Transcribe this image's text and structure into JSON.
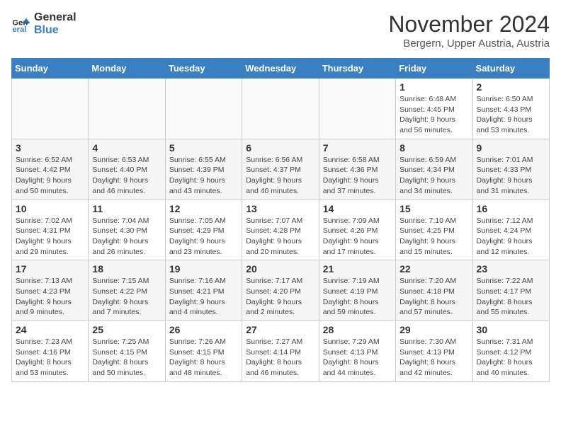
{
  "logo": {
    "line1": "General",
    "line2": "Blue"
  },
  "title": "November 2024",
  "location": "Bergern, Upper Austria, Austria",
  "days_of_week": [
    "Sunday",
    "Monday",
    "Tuesday",
    "Wednesday",
    "Thursday",
    "Friday",
    "Saturday"
  ],
  "weeks": [
    [
      {
        "day": "",
        "info": ""
      },
      {
        "day": "",
        "info": ""
      },
      {
        "day": "",
        "info": ""
      },
      {
        "day": "",
        "info": ""
      },
      {
        "day": "",
        "info": ""
      },
      {
        "day": "1",
        "info": "Sunrise: 6:48 AM\nSunset: 4:45 PM\nDaylight: 9 hours\nand 56 minutes."
      },
      {
        "day": "2",
        "info": "Sunrise: 6:50 AM\nSunset: 4:43 PM\nDaylight: 9 hours\nand 53 minutes."
      }
    ],
    [
      {
        "day": "3",
        "info": "Sunrise: 6:52 AM\nSunset: 4:42 PM\nDaylight: 9 hours\nand 50 minutes."
      },
      {
        "day": "4",
        "info": "Sunrise: 6:53 AM\nSunset: 4:40 PM\nDaylight: 9 hours\nand 46 minutes."
      },
      {
        "day": "5",
        "info": "Sunrise: 6:55 AM\nSunset: 4:39 PM\nDaylight: 9 hours\nand 43 minutes."
      },
      {
        "day": "6",
        "info": "Sunrise: 6:56 AM\nSunset: 4:37 PM\nDaylight: 9 hours\nand 40 minutes."
      },
      {
        "day": "7",
        "info": "Sunrise: 6:58 AM\nSunset: 4:36 PM\nDaylight: 9 hours\nand 37 minutes."
      },
      {
        "day": "8",
        "info": "Sunrise: 6:59 AM\nSunset: 4:34 PM\nDaylight: 9 hours\nand 34 minutes."
      },
      {
        "day": "9",
        "info": "Sunrise: 7:01 AM\nSunset: 4:33 PM\nDaylight: 9 hours\nand 31 minutes."
      }
    ],
    [
      {
        "day": "10",
        "info": "Sunrise: 7:02 AM\nSunset: 4:31 PM\nDaylight: 9 hours\nand 29 minutes."
      },
      {
        "day": "11",
        "info": "Sunrise: 7:04 AM\nSunset: 4:30 PM\nDaylight: 9 hours\nand 26 minutes."
      },
      {
        "day": "12",
        "info": "Sunrise: 7:05 AM\nSunset: 4:29 PM\nDaylight: 9 hours\nand 23 minutes."
      },
      {
        "day": "13",
        "info": "Sunrise: 7:07 AM\nSunset: 4:28 PM\nDaylight: 9 hours\nand 20 minutes."
      },
      {
        "day": "14",
        "info": "Sunrise: 7:09 AM\nSunset: 4:26 PM\nDaylight: 9 hours\nand 17 minutes."
      },
      {
        "day": "15",
        "info": "Sunrise: 7:10 AM\nSunset: 4:25 PM\nDaylight: 9 hours\nand 15 minutes."
      },
      {
        "day": "16",
        "info": "Sunrise: 7:12 AM\nSunset: 4:24 PM\nDaylight: 9 hours\nand 12 minutes."
      }
    ],
    [
      {
        "day": "17",
        "info": "Sunrise: 7:13 AM\nSunset: 4:23 PM\nDaylight: 9 hours\nand 9 minutes."
      },
      {
        "day": "18",
        "info": "Sunrise: 7:15 AM\nSunset: 4:22 PM\nDaylight: 9 hours\nand 7 minutes."
      },
      {
        "day": "19",
        "info": "Sunrise: 7:16 AM\nSunset: 4:21 PM\nDaylight: 9 hours\nand 4 minutes."
      },
      {
        "day": "20",
        "info": "Sunrise: 7:17 AM\nSunset: 4:20 PM\nDaylight: 9 hours\nand 2 minutes."
      },
      {
        "day": "21",
        "info": "Sunrise: 7:19 AM\nSunset: 4:19 PM\nDaylight: 8 hours\nand 59 minutes."
      },
      {
        "day": "22",
        "info": "Sunrise: 7:20 AM\nSunset: 4:18 PM\nDaylight: 8 hours\nand 57 minutes."
      },
      {
        "day": "23",
        "info": "Sunrise: 7:22 AM\nSunset: 4:17 PM\nDaylight: 8 hours\nand 55 minutes."
      }
    ],
    [
      {
        "day": "24",
        "info": "Sunrise: 7:23 AM\nSunset: 4:16 PM\nDaylight: 8 hours\nand 53 minutes."
      },
      {
        "day": "25",
        "info": "Sunrise: 7:25 AM\nSunset: 4:15 PM\nDaylight: 8 hours\nand 50 minutes."
      },
      {
        "day": "26",
        "info": "Sunrise: 7:26 AM\nSunset: 4:15 PM\nDaylight: 8 hours\nand 48 minutes."
      },
      {
        "day": "27",
        "info": "Sunrise: 7:27 AM\nSunset: 4:14 PM\nDaylight: 8 hours\nand 46 minutes."
      },
      {
        "day": "28",
        "info": "Sunrise: 7:29 AM\nSunset: 4:13 PM\nDaylight: 8 hours\nand 44 minutes."
      },
      {
        "day": "29",
        "info": "Sunrise: 7:30 AM\nSunset: 4:13 PM\nDaylight: 8 hours\nand 42 minutes."
      },
      {
        "day": "30",
        "info": "Sunrise: 7:31 AM\nSunset: 4:12 PM\nDaylight: 8 hours\nand 40 minutes."
      }
    ]
  ]
}
